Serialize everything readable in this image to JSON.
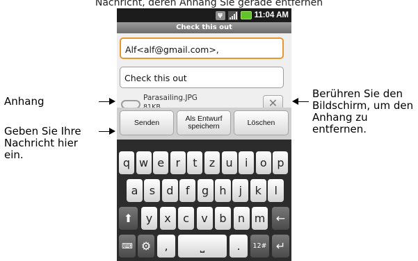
{
  "top_caption": "Nachricht, deren Anhang Sie gerade entfernen",
  "annotations": {
    "anhang": "Anhang",
    "geben": "Geben Sie Ihre Nachricht hier ein.",
    "beruehren": "Berühren Sie den Bildschirm, um den Anhang zu entfernen."
  },
  "status_bar": {
    "time": "11:04 AM",
    "icons": [
      "usb-icon",
      "signal-icon",
      "battery-icon"
    ],
    "battery_color": "#63c22b"
  },
  "title": "Check this out",
  "compose": {
    "to_value": "Alf<alf@gmail.com>,",
    "subject_value": "Check this out",
    "focus_color": "#e8962e"
  },
  "attachment": {
    "name": "Parasailing.JPG",
    "size": "81KB",
    "remove_glyph": "✕"
  },
  "buttons": {
    "send": "Senden",
    "draft": "Als Entwurf speichern",
    "discard": "Löschen"
  },
  "keyboard": {
    "row1": [
      "q",
      "w",
      "e",
      "r",
      "t",
      "z",
      "u",
      "i",
      "o",
      "p"
    ],
    "row2": [
      "a",
      "s",
      "d",
      "f",
      "g",
      "h",
      "j",
      "k",
      "l"
    ],
    "row3": [
      "y",
      "x",
      "c",
      "v",
      "b",
      "n",
      "m"
    ],
    "shift": "⬆",
    "delete": "←",
    "comma": ",",
    "space": "⎵",
    "period": ".",
    "sym": "12#",
    "enter": "↵",
    "settings": "⚙"
  }
}
